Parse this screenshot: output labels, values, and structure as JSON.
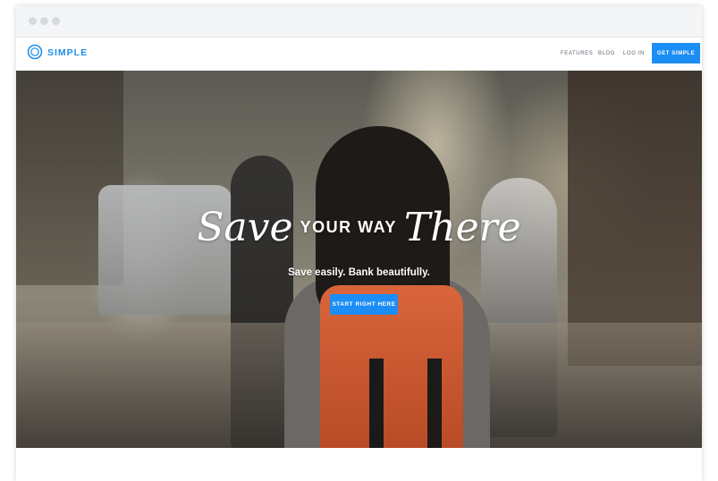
{
  "brand": {
    "name": "SIMPLE",
    "accent": "#1b8df5",
    "logo_icon": "simple-logo-icon"
  },
  "nav": {
    "links": [
      {
        "label": "FEATURES"
      },
      {
        "label": "BLOG"
      },
      {
        "label": "LOG IN"
      }
    ],
    "cta": "GET SIMPLE"
  },
  "hero": {
    "title_part1": "Save",
    "title_part2": "YOUR WAY",
    "title_part3": "There",
    "subtitle": "Save easily. Bank beautifully.",
    "button": "START RIGHT HERE"
  }
}
